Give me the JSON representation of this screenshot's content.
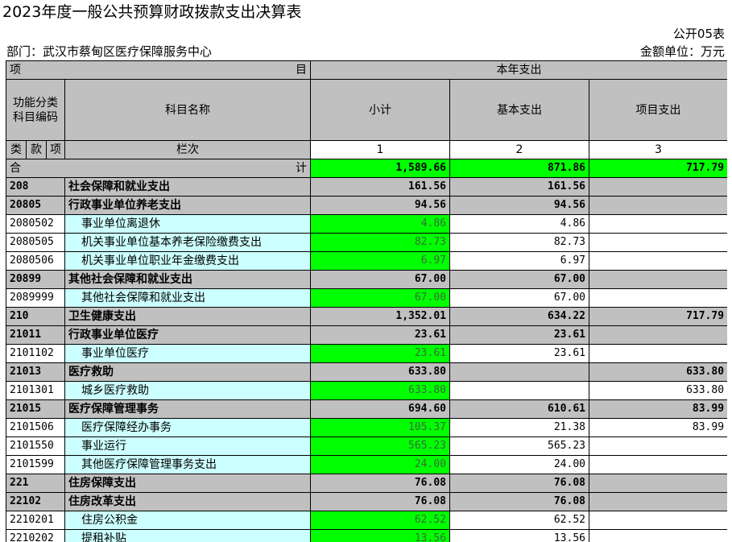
{
  "title": "2023年度一般公共预算财政拨款支出决算表",
  "report_code": "公开05表",
  "department": "部门：武汉市蔡甸区医疗保障服务中心",
  "unit": "金额单位：万元",
  "header": {
    "xiang": "项",
    "mu": "目",
    "this_year": "本年支出",
    "func_code_l1": "功能分类",
    "func_code_l2": "科目编码",
    "subject_name": "科目名称",
    "subtotal": "小计",
    "basic": "基本支出",
    "project": "项目支出",
    "lanci": "栏次",
    "lei": "类",
    "kuan": "款",
    "xiang2": "项",
    "col1": "1",
    "col2": "2",
    "col3": "3",
    "he": "合",
    "ji": "计"
  },
  "total": {
    "subtotal": "1,589.66",
    "basic": "871.86",
    "project": "717.79"
  },
  "rows": [
    {
      "code": "208",
      "name": "社会保障和就业支出",
      "subtotal": "161.56",
      "basic": "161.56",
      "project": ""
    },
    {
      "code": "20805",
      "name": "行政事业单位养老支出",
      "subtotal": "94.56",
      "basic": "94.56",
      "project": ""
    },
    {
      "code": "2080502",
      "name": "事业单位离退休",
      "subtotal": "4.86",
      "basic": "4.86",
      "project": ""
    },
    {
      "code": "2080505",
      "name": "机关事业单位基本养老保险缴费支出",
      "subtotal": "82.73",
      "basic": "82.73",
      "project": ""
    },
    {
      "code": "2080506",
      "name": "机关事业单位职业年金缴费支出",
      "subtotal": "6.97",
      "basic": "6.97",
      "project": ""
    },
    {
      "code": "20899",
      "name": "其他社会保障和就业支出",
      "subtotal": "67.00",
      "basic": "67.00",
      "project": ""
    },
    {
      "code": "2089999",
      "name": "其他社会保障和就业支出",
      "subtotal": "67.00",
      "basic": "67.00",
      "project": ""
    },
    {
      "code": "210",
      "name": "卫生健康支出",
      "subtotal": "1,352.01",
      "basic": "634.22",
      "project": "717.79"
    },
    {
      "code": "21011",
      "name": "行政事业单位医疗",
      "subtotal": "23.61",
      "basic": "23.61",
      "project": ""
    },
    {
      "code": "2101102",
      "name": "事业单位医疗",
      "subtotal": "23.61",
      "basic": "23.61",
      "project": ""
    },
    {
      "code": "21013",
      "name": "医疗救助",
      "subtotal": "633.80",
      "basic": "",
      "project": "633.80"
    },
    {
      "code": "2101301",
      "name": "城乡医疗救助",
      "subtotal": "633.80",
      "basic": "",
      "project": "633.80"
    },
    {
      "code": "21015",
      "name": "医疗保障管理事务",
      "subtotal": "694.60",
      "basic": "610.61",
      "project": "83.99"
    },
    {
      "code": "2101506",
      "name": "医疗保障经办事务",
      "subtotal": "105.37",
      "basic": "21.38",
      "project": "83.99"
    },
    {
      "code": "2101550",
      "name": "事业运行",
      "subtotal": "565.23",
      "basic": "565.23",
      "project": ""
    },
    {
      "code": "2101599",
      "name": "其他医疗保障管理事务支出",
      "subtotal": "24.00",
      "basic": "24.00",
      "project": ""
    },
    {
      "code": "221",
      "name": "住房保障支出",
      "subtotal": "76.08",
      "basic": "76.08",
      "project": ""
    },
    {
      "code": "22102",
      "name": "住房改革支出",
      "subtotal": "76.08",
      "basic": "76.08",
      "project": ""
    },
    {
      "code": "2210201",
      "name": "住房公积金",
      "subtotal": "62.52",
      "basic": "62.52",
      "project": ""
    },
    {
      "code": "2210202",
      "name": "提租补贴",
      "subtotal": "13.56",
      "basic": "13.56",
      "project": ""
    }
  ]
}
